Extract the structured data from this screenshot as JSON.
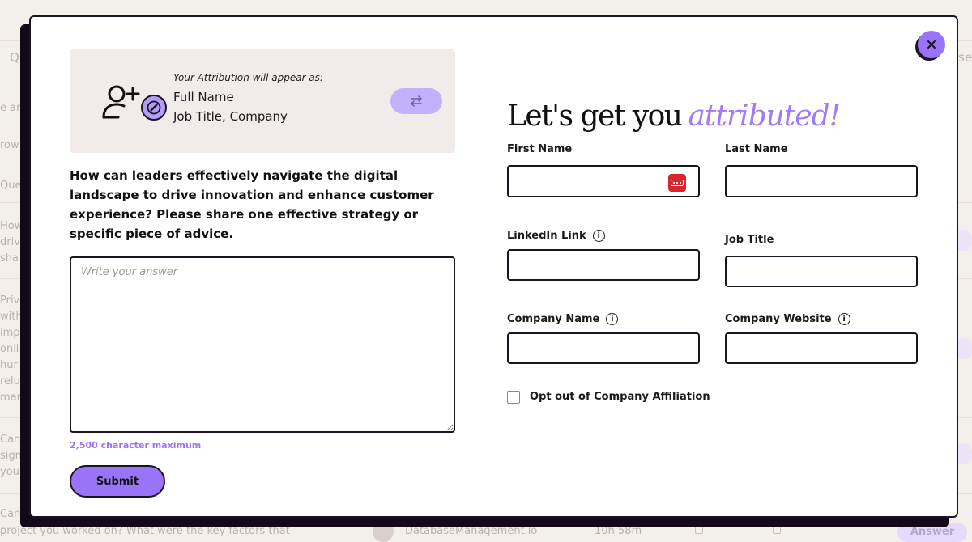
{
  "background": {
    "search_letter": "Q",
    "right_fragment": "sel",
    "left_fragments": [
      "e ar",
      "row",
      "Que",
      "How",
      "driv",
      "sha",
      "Priv",
      "with",
      "imp",
      "onli",
      "hur",
      "relu",
      "mar",
      "Can",
      "sign",
      "you",
      "Can"
    ],
    "footer_text": "project you worked on? What were the key factors that",
    "footer_source": "DatabaseManagement.io",
    "footer_time": "10h 58m",
    "answer_label": "Answer"
  },
  "modal": {
    "close_icon": "close-icon",
    "attribution": {
      "caption": "Your Attribution will appear as:",
      "name": "Full Name",
      "job": "Job Title, Company",
      "user_icon": "add-user-icon",
      "edit_icon": "pencil-icon",
      "swap_icon": "swap-arrows-icon"
    },
    "question": "How can leaders effectively navigate the digital landscape to drive innovation and enhance customer experience? Please share one effective strategy or specific piece of advice.",
    "answer": {
      "placeholder": "Write your answer",
      "value": "",
      "limit_note": "2,500 character maximum"
    },
    "submit_label": "Submit",
    "heading": {
      "main": "Let's get you",
      "accent": "attributed!"
    },
    "fields": {
      "first_name": {
        "label": "First Name",
        "value": ""
      },
      "last_name": {
        "label": "Last Name",
        "value": ""
      },
      "linkedin": {
        "label": "LinkedIn Link",
        "value": ""
      },
      "job_title": {
        "label": "Job Title",
        "value": ""
      },
      "company_name": {
        "label": "Company Name",
        "value": ""
      },
      "company_website": {
        "label": "Company Website",
        "value": ""
      }
    },
    "opt_out_label": "Opt out of Company Affiliation",
    "opt_out_checked": false
  },
  "colors": {
    "accent": "#9a74f8",
    "accent_light": "#c3b0fa",
    "dark": "#1c1420",
    "card_bg": "#f1ecea",
    "page_bg": "#f3efeb"
  }
}
